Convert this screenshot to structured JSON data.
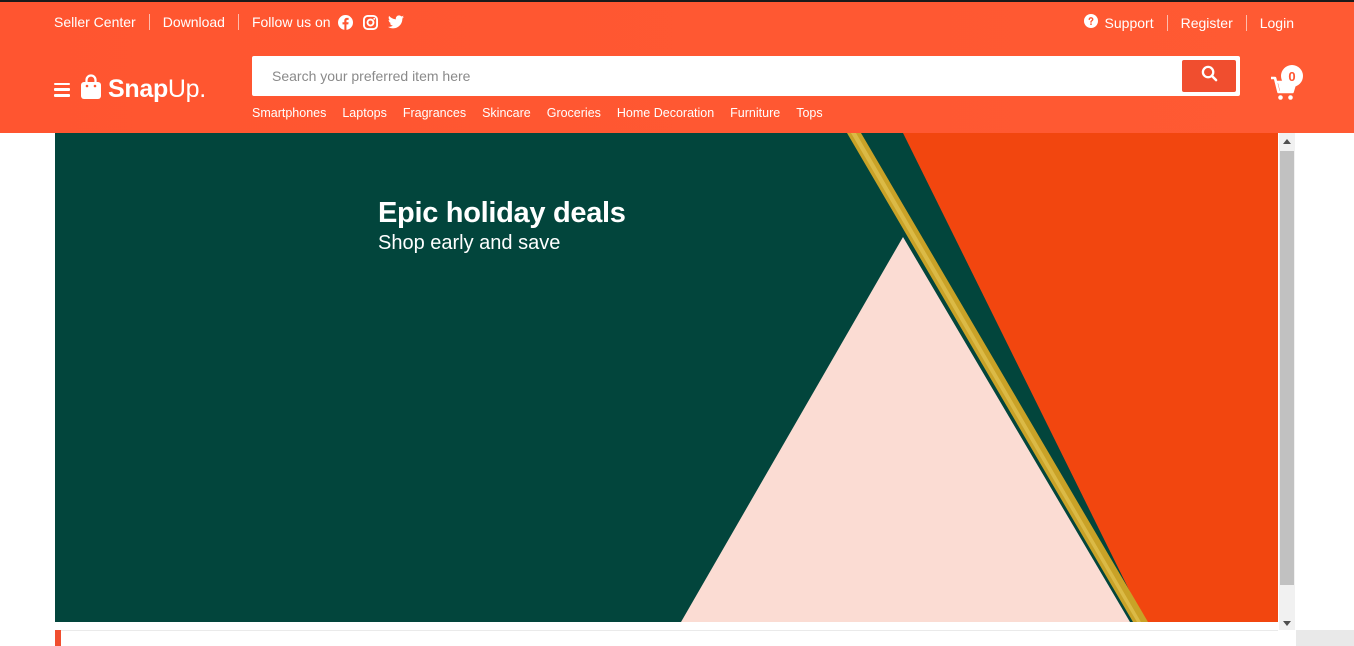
{
  "topbar": {
    "seller_center": "Seller Center",
    "download": "Download",
    "follow_us": "Follow us on",
    "support": "Support",
    "register": "Register",
    "login": "Login"
  },
  "brand": {
    "name_bold": "Snap",
    "name_light": "Up."
  },
  "search": {
    "placeholder": "Search your preferred item here"
  },
  "categories": [
    "Smartphones",
    "Laptops",
    "Fragrances",
    "Skincare",
    "Groceries",
    "Home Decoration",
    "Furniture",
    "Tops"
  ],
  "cart": {
    "count": "0"
  },
  "banner": {
    "title": "Epic holiday deals",
    "subtitle": "Shop early and save"
  },
  "colors": {
    "header": "#ff5530",
    "banner_green": "#02453c",
    "banner_orange": "#f2460f",
    "banner_pink": "#fbdcd3",
    "banner_gold": "#c9a227"
  }
}
